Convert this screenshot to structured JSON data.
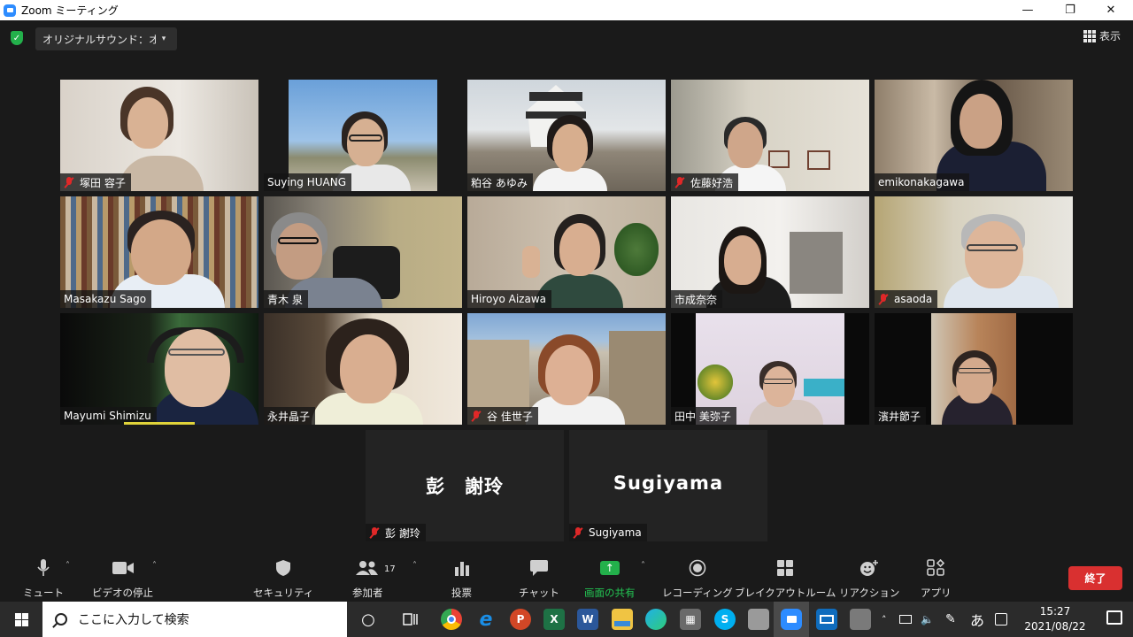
{
  "window": {
    "title": "Zoom ミーティング",
    "controls": {
      "minimize": "—",
      "restore": "❐",
      "close": "✕"
    }
  },
  "topbar": {
    "original_sound_label": "オリジナルサウンド：オフ",
    "dropdown_glyph": "▾",
    "view_label": "表示",
    "security_glyph": "✓"
  },
  "participants": [
    {
      "name": "塚田 容子",
      "muted": true,
      "active": false
    },
    {
      "name": "Suying HUANG",
      "muted": false,
      "active": false
    },
    {
      "name": "粕谷 あゆみ",
      "muted": false,
      "active": false
    },
    {
      "name": "佐藤好浩",
      "muted": true,
      "active": false
    },
    {
      "name": "emikonakagawa",
      "muted": false,
      "active": false
    },
    {
      "name": "Masakazu Sago",
      "muted": false,
      "active": false
    },
    {
      "name": "青木 泉",
      "muted": false,
      "active": false
    },
    {
      "name": "Hiroyo Aizawa",
      "muted": false,
      "active": true
    },
    {
      "name": "市成奈奈",
      "muted": false,
      "active": false
    },
    {
      "name": "asaoda",
      "muted": true,
      "active": false
    },
    {
      "name": "Mayumi Shimizu",
      "muted": false,
      "active": false
    },
    {
      "name": "永井晶子",
      "muted": false,
      "active": false
    },
    {
      "name": "谷 佳世子",
      "muted": true,
      "active": false
    },
    {
      "name": "田中 美弥子",
      "muted": false,
      "active": false
    },
    {
      "name": "濱井節子",
      "muted": false,
      "active": false
    }
  ],
  "no_video_participants": [
    {
      "display": "彭　謝玲",
      "name": "彭 謝玲",
      "muted": true
    },
    {
      "display": "Sugiyama",
      "name": "Sugiyama",
      "muted": true
    }
  ],
  "toolbar": {
    "mute": "ミュート",
    "stop_video": "ビデオの停止",
    "security": "セキュリティ",
    "participants": "参加者",
    "participant_count": "17",
    "polls": "投票",
    "chat": "チャット",
    "share_screen": "画面の共有",
    "recording": "レコーディング",
    "breakout": "ブレイクアウトルーム",
    "reactions": "リアクション",
    "apps": "アプリ",
    "end": "終了",
    "caret": "˄"
  },
  "taskbar": {
    "search_placeholder": "ここに入力して検索",
    "time": "15:27",
    "date": "2021/08/22",
    "ime": "あ",
    "apps": [
      "cortana-icon",
      "task-view-icon",
      "chrome-icon",
      "edge-legacy-icon",
      "powerpoint-icon",
      "excel-icon",
      "word-icon",
      "file-explorer-icon",
      "edge-icon",
      "calculator-icon",
      "skype-icon",
      "scanner-icon",
      "zoom-icon",
      "mail-icon",
      "device-icon"
    ],
    "app_glyphs": {
      "powerpoint": "P",
      "excel": "X",
      "word": "W",
      "skype": "S",
      "edge_legacy": "e",
      "tray_up": "˄",
      "volume": "🔈",
      "pen": "✎",
      "cortana": "○",
      "calc": "▦"
    }
  },
  "colors": {
    "accent_green": "#23b04b",
    "active_speaker": "#d7e63a",
    "end_red": "#d93030",
    "mute_red": "#e02828",
    "zoom_blue": "#2d8cff"
  }
}
